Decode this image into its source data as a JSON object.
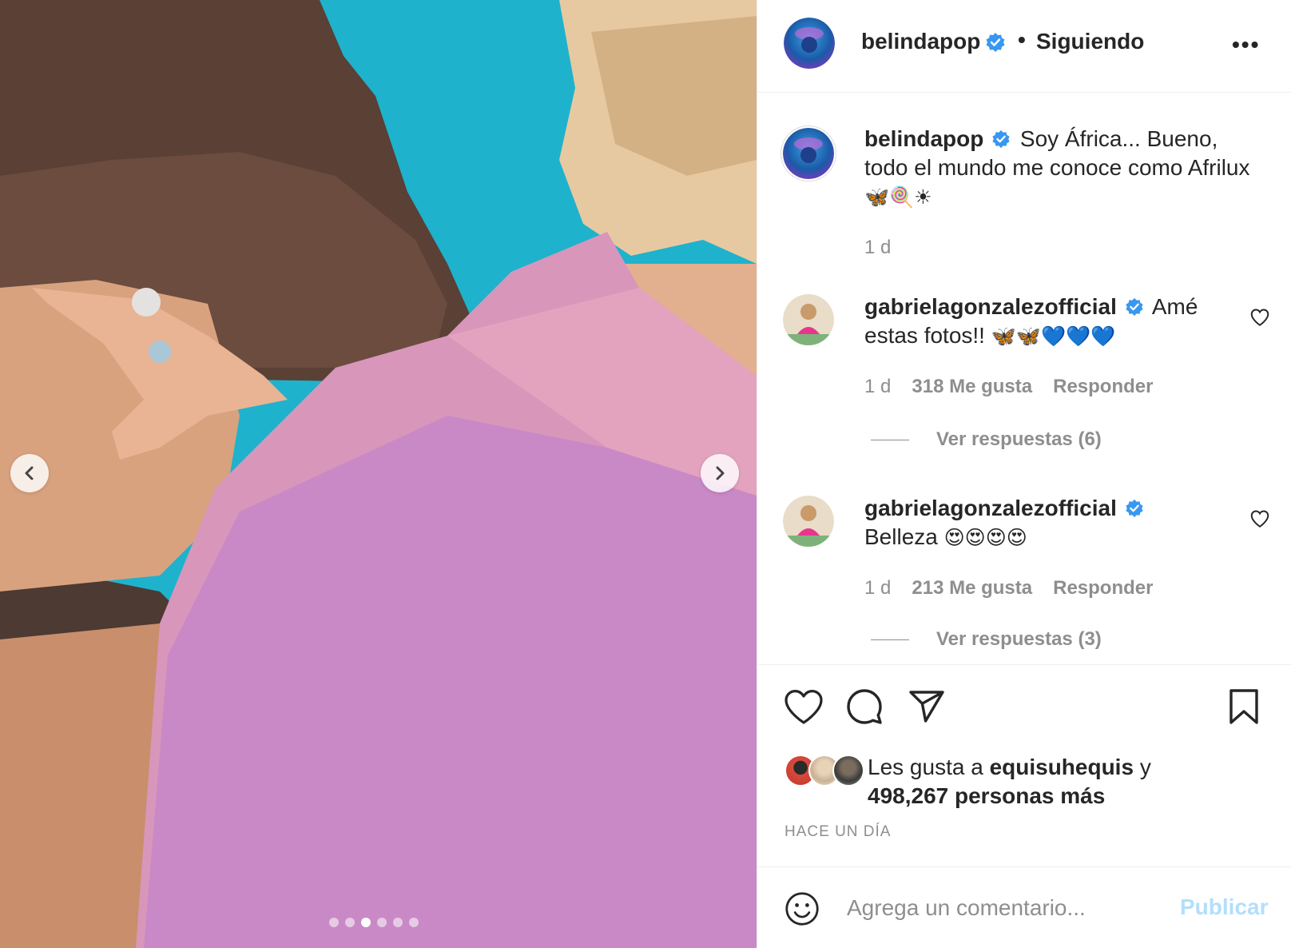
{
  "media": {
    "slide_count": 6,
    "active_slide": 3,
    "prev_icon": "chevron-left-icon",
    "next_icon": "chevron-right-icon"
  },
  "header": {
    "username": "belindapop",
    "separator": "•",
    "follow_status": "Siguiendo",
    "more_label": "•••"
  },
  "caption": {
    "username": "belindapop",
    "text": "Soy África... Bueno, todo el mundo me conoce como Afrilux",
    "emojis": "🦋🍭☀",
    "time": "1 d"
  },
  "comments": [
    {
      "username": "gabrielagonzalezofficial",
      "text": "Amé estas fotos!!",
      "emojis": "🦋🦋💙💙💙",
      "time": "1 d",
      "likes": "318 Me gusta",
      "reply_label": "Responder",
      "view_replies": "Ver respuestas (6)"
    },
    {
      "username": "gabrielagonzalezofficial",
      "text": "Belleza",
      "emojis": "😍😍😍😍",
      "time": "1 d",
      "likes": "213 Me gusta",
      "reply_label": "Responder",
      "view_replies": "Ver respuestas (3)"
    }
  ],
  "likes": {
    "prefix": "Les gusta a",
    "user": "equisuhequis",
    "conj": "y",
    "others": "498,267 personas más"
  },
  "post_date": "HACE UN DÍA",
  "add_comment": {
    "placeholder": "Agrega un comentario...",
    "publish": "Publicar"
  },
  "colors": {
    "verified": "#3897f0",
    "publish_disabled": "#b2dffc",
    "muted": "#8e8e8e"
  }
}
